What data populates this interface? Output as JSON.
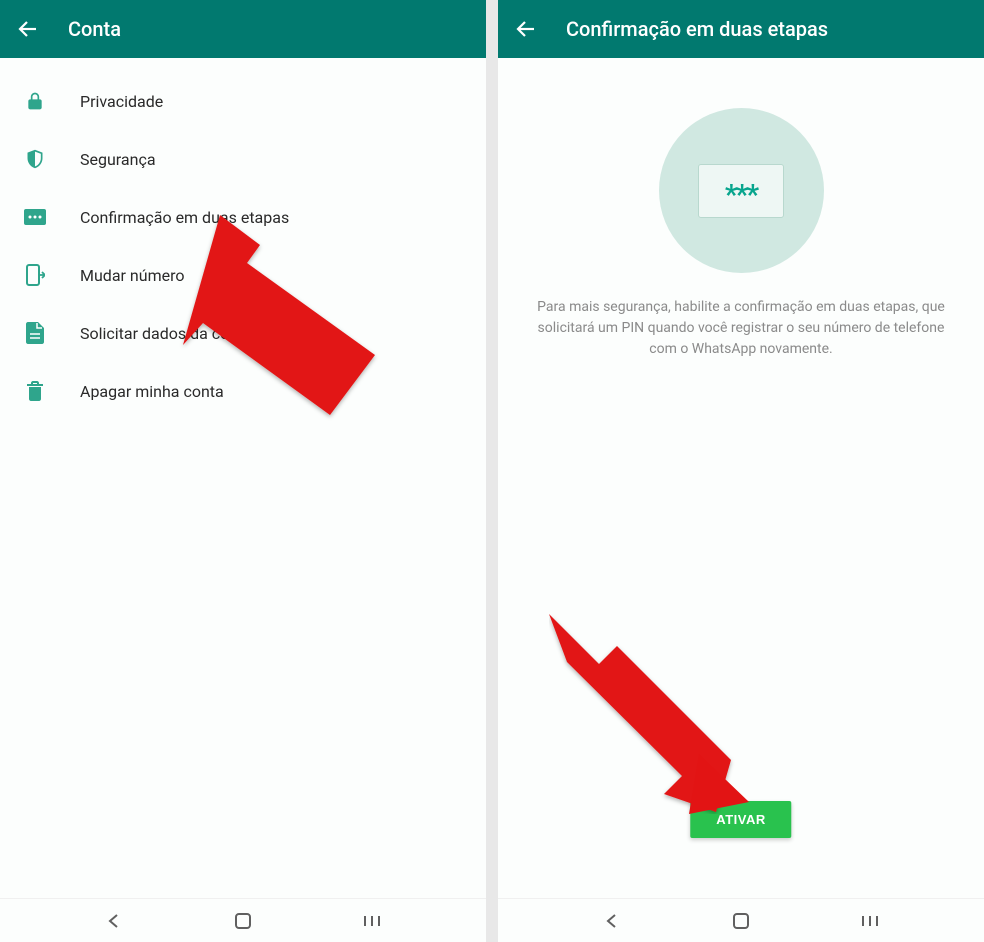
{
  "leftScreen": {
    "headerTitle": "Conta",
    "menuItems": [
      {
        "label": "Privacidade",
        "icon": "lock"
      },
      {
        "label": "Segurança",
        "icon": "shield"
      },
      {
        "label": "Confirmação em duas etapas",
        "icon": "pin"
      },
      {
        "label": "Mudar número",
        "icon": "phone-swap"
      },
      {
        "label": "Solicitar dados da conta",
        "icon": "document"
      },
      {
        "label": "Apagar minha conta",
        "icon": "trash"
      }
    ]
  },
  "rightScreen": {
    "headerTitle": "Confirmação em duas etapas",
    "pinStars": "***",
    "description": "Para mais segurança, habilite a confirmação em duas etapas, que solicitará um PIN quando você registrar o seu número de telefone com o WhatsApp novamente.",
    "activateButton": "ATIVAR"
  }
}
